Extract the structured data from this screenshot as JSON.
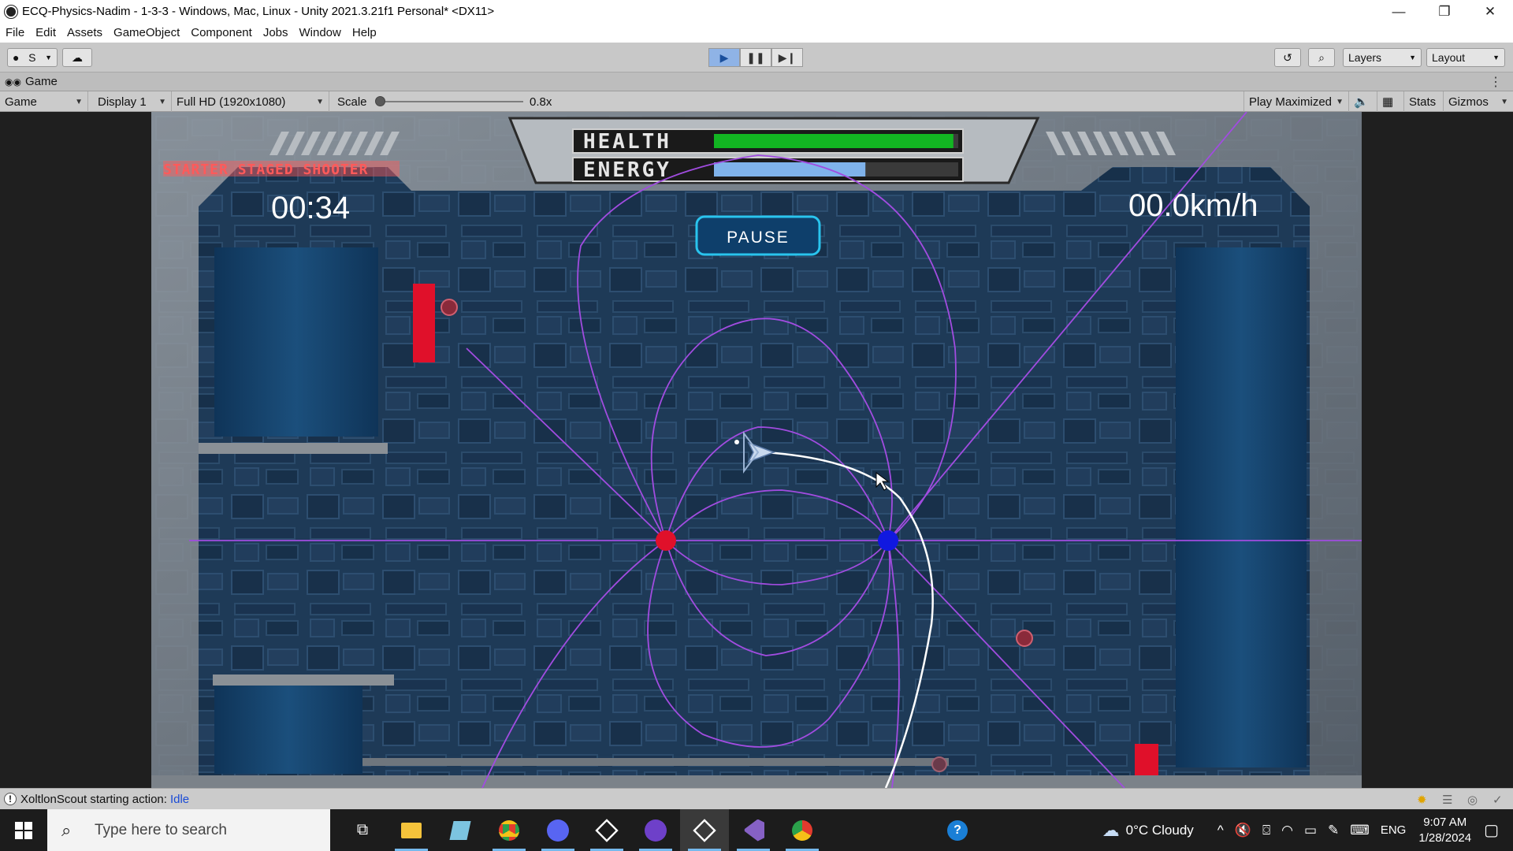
{
  "window": {
    "title": "ECQ-Physics-Nadim - 1-3-3 - Windows, Mac, Linux - Unity 2021.3.21f1 Personal* <DX11>",
    "controls": [
      "—",
      "❐",
      "✕"
    ]
  },
  "menu": [
    "File",
    "Edit",
    "Assets",
    "GameObject",
    "Component",
    "Jobs",
    "Window",
    "Help"
  ],
  "toolbar": {
    "account_label": "S",
    "layers_label": "Layers",
    "layout_label": "Layout",
    "play_active": true
  },
  "tab": {
    "label": "Game"
  },
  "game_controls": {
    "mode": "Game",
    "display": "Display 1",
    "resolution": "Full HD (1920x1080)",
    "scale_label": "Scale",
    "scale_value": "0.8x",
    "scale_fraction": 0.0,
    "play_mode": "Play Maximized",
    "stats": "Stats",
    "gizmos": "Gizmos"
  },
  "game": {
    "subtitle": "STARTER STAGED SHOOTER",
    "timer": "00:34",
    "speed": "00.0km/h",
    "health_label": "HEALTH",
    "energy_label": "ENERGY",
    "health_fraction": 0.98,
    "energy_fraction": 0.62,
    "pause_label": "PAUSE"
  },
  "status": {
    "message": "XoltlonScout starting action:",
    "action": "Idle"
  },
  "taskbar": {
    "search_placeholder": "Type here to search",
    "weather": "0°C  Cloudy",
    "language": "ENG",
    "time": "9:07 AM",
    "date": "1/28/2024"
  },
  "colors": {
    "play_accent": "#8fb3e6",
    "health_bar": "#12b522",
    "energy_bar": "#7fb2ea",
    "field_lines": "#a14ce0",
    "positive_charge": "#e0102a",
    "negative_charge": "#1018e0",
    "subtitle": "#ff5a5a"
  }
}
